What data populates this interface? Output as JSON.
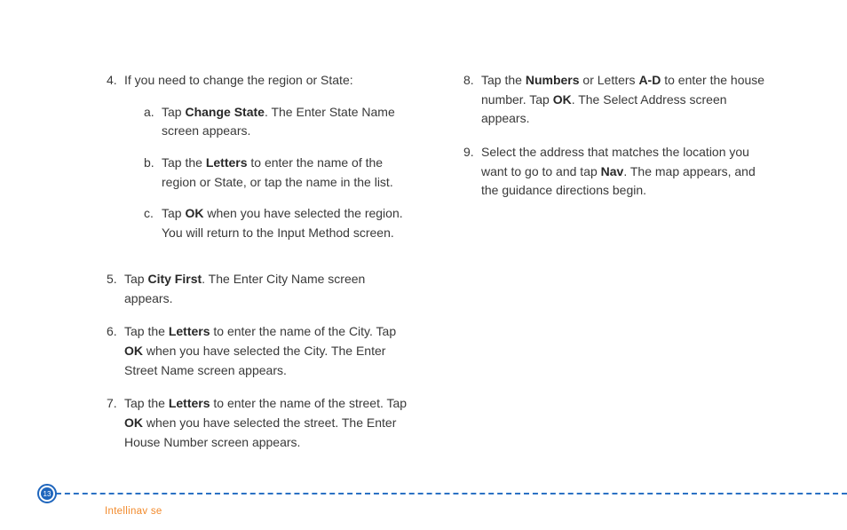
{
  "left_column": {
    "item4": {
      "num": "4.",
      "intro": "If you need to change the region or State:",
      "subs": [
        {
          "letter": "a.",
          "pre": "Tap ",
          "bold": "Change State",
          "post": ". The Enter State Name screen appears."
        },
        {
          "letter": "b.",
          "pre": "Tap the ",
          "bold": "Letters",
          "post": " to enter the name of the region or State, or tap the name in the list."
        },
        {
          "letter": "c.",
          "pre": "Tap ",
          "bold": "OK",
          "post": " when you have selected the region. You will return to the Input Method screen."
        }
      ]
    },
    "item5": {
      "num": "5.",
      "pre": "Tap ",
      "bold": "City First",
      "post": ". The Enter City Name screen appears."
    },
    "item6": {
      "num": "6.",
      "pre": "Tap the ",
      "bold1": "Letters",
      "mid": " to enter the name of the City. Tap ",
      "bold2": "OK",
      "post": " when you have selected the City. The Enter Street Name screen appears."
    },
    "item7": {
      "num": "7.",
      "pre": "Tap the ",
      "bold1": "Letters",
      "mid": " to enter the name of the street. Tap ",
      "bold2": "OK",
      "post": " when you have selected the street. The Enter House Number screen appears."
    }
  },
  "right_column": {
    "item8": {
      "num": "8.",
      "pre": "Tap the ",
      "bold1": "Numbers",
      "mid1": " or Letters ",
      "bold2": "A-D",
      "mid2": " to enter the house number. Tap ",
      "bold3": "OK",
      "post": ". The Select Address screen appears."
    },
    "item9": {
      "num": "9.",
      "pre": "Select the address that matches the location you want to go to and tap ",
      "bold": "Nav",
      "post": ". The map appears, and the guidance directions begin."
    }
  },
  "footer": {
    "page": "13",
    "label": "Intellinav se"
  }
}
